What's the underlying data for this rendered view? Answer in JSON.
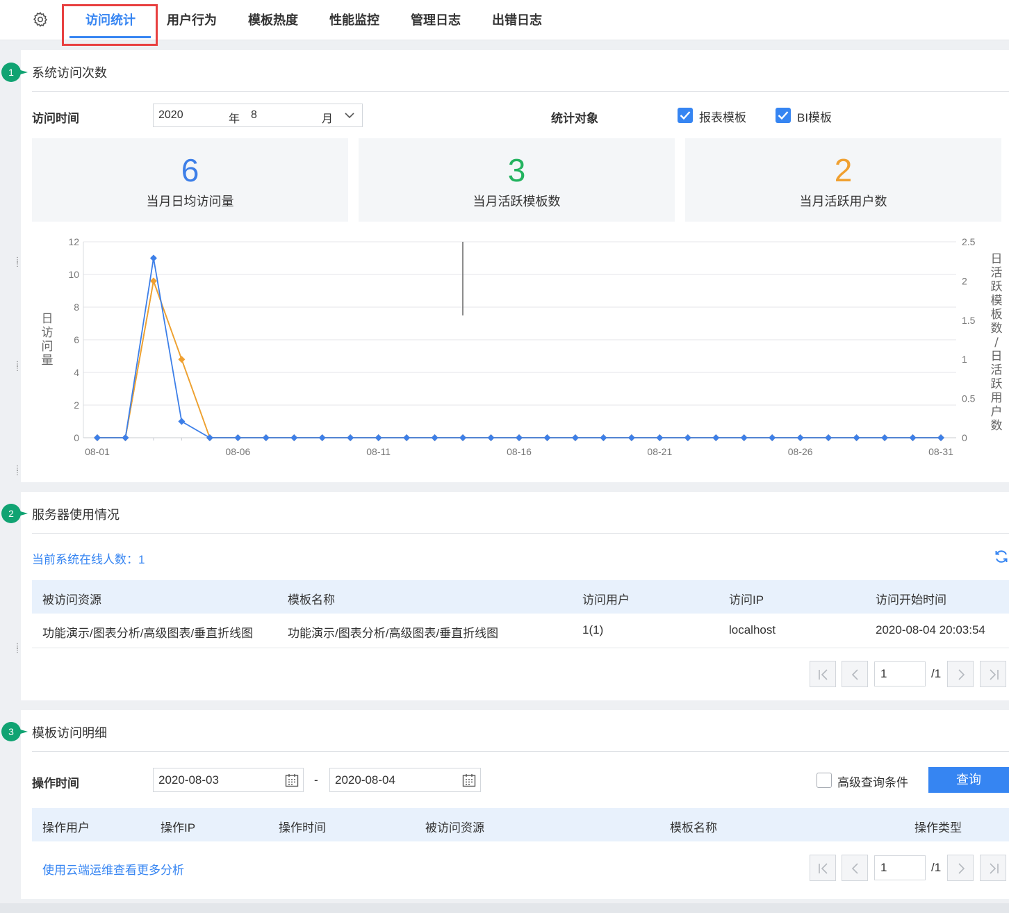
{
  "tabs": [
    {
      "label": "访问统计",
      "active": true
    },
    {
      "label": "用户行为"
    },
    {
      "label": "模板热度"
    },
    {
      "label": "性能监控"
    },
    {
      "label": "管理日志"
    },
    {
      "label": "出错日志"
    }
  ],
  "icons": {
    "settings": "gear-icon"
  },
  "colors": {
    "accent": "#3685f2",
    "badge": "#10a372",
    "highlight": "#e84040",
    "series_visits": "#3d7fe8",
    "series_active": "#f0a030",
    "stat_green": "#23b35f"
  },
  "section1": {
    "badge": "1",
    "title": "系统访问次数",
    "time_label": "访问时间",
    "year": "2020",
    "year_unit": "年",
    "month": "8",
    "month_unit": "月",
    "target_label": "统计对象",
    "checkboxes": [
      {
        "label": "报表模板",
        "checked": true
      },
      {
        "label": "BI模板",
        "checked": true
      }
    ],
    "stats": [
      {
        "value": "6",
        "label": "当月日均访问量",
        "color": "#3d7fe8"
      },
      {
        "value": "3",
        "label": "当月活跃模板数",
        "color": "#23b35f"
      },
      {
        "value": "2",
        "label": "当月活跃用户数",
        "color": "#f0a030"
      }
    ]
  },
  "chart_data": {
    "type": "line",
    "x": [
      "08-01",
      "08-02",
      "08-03",
      "08-04",
      "08-05",
      "08-06",
      "08-07",
      "08-08",
      "08-09",
      "08-10",
      "08-11",
      "08-12",
      "08-13",
      "08-14",
      "08-15",
      "08-16",
      "08-17",
      "08-18",
      "08-19",
      "08-20",
      "08-21",
      "08-22",
      "08-23",
      "08-24",
      "08-25",
      "08-26",
      "08-27",
      "08-28",
      "08-29",
      "08-30",
      "08-31"
    ],
    "x_tick_labels": [
      "08-01",
      "08-06",
      "08-11",
      "08-16",
      "08-21",
      "08-26",
      "08-31"
    ],
    "ylabel": "日访问量",
    "y2label": "日活跃模板数/日活跃用户数",
    "ylim": [
      0,
      12
    ],
    "y_ticks": [
      "0",
      "2",
      "4",
      "6",
      "8",
      "10",
      "12"
    ],
    "y2lim": [
      0,
      2.5
    ],
    "y2_ticks": [
      "0",
      "0.5",
      "1",
      "1.5",
      "2",
      "2.5"
    ],
    "grid": true,
    "series": [
      {
        "axis": "left",
        "color": "#3d7fe8",
        "marker": "diamond",
        "values": [
          0,
          0,
          11,
          1,
          0,
          0,
          0,
          0,
          0,
          0,
          0,
          0,
          0,
          0,
          0,
          0,
          0,
          0,
          0,
          0,
          0,
          0,
          0,
          0,
          0,
          0,
          0,
          0,
          0,
          0,
          0
        ]
      },
      {
        "axis": "right",
        "color": "#f0a030",
        "marker": "diamond",
        "values": [
          0,
          0,
          2,
          1,
          0,
          0,
          0,
          0,
          0,
          0,
          0,
          0,
          0,
          0,
          0,
          0,
          0,
          0,
          0,
          0,
          0,
          0,
          0,
          0,
          0,
          0,
          0,
          0,
          0,
          0,
          0
        ]
      },
      {
        "axis": "right",
        "color": "#c9b040",
        "marker": "none",
        "values": [
          0,
          0,
          2,
          1,
          0,
          0,
          0,
          0,
          0,
          0,
          0,
          0,
          0,
          0,
          0,
          0,
          0,
          0,
          0,
          0,
          0,
          0,
          0,
          0,
          0,
          0,
          0,
          0,
          0,
          0,
          0
        ]
      }
    ]
  },
  "section2": {
    "badge": "2",
    "title": "服务器使用情况",
    "online_text": "当前系统在线人数：1",
    "columns": [
      "被访问资源",
      "模板名称",
      "访问用户",
      "访问IP",
      "访问开始时间"
    ],
    "rows": [
      [
        "功能演示/图表分析/高级图表/垂直折线图",
        "功能演示/图表分析/高级图表/垂直折线图",
        "1(1)",
        "localhost",
        "2020-08-04 20:03:54"
      ]
    ],
    "pager": {
      "page": "1",
      "total": "/1"
    }
  },
  "section3": {
    "badge": "3",
    "title": "模板访问明细",
    "time_label": "操作时间",
    "start_date": "2020-08-03",
    "end_date": "2020-08-04",
    "dash": "-",
    "advanced_label": "高级查询条件",
    "query_label": "查询",
    "columns": [
      "操作用户",
      "操作IP",
      "操作时间",
      "被访问资源",
      "模板名称",
      "操作类型"
    ],
    "link_text": "使用云端运维查看更多分析",
    "pager": {
      "page": "1",
      "total": "/1"
    }
  }
}
